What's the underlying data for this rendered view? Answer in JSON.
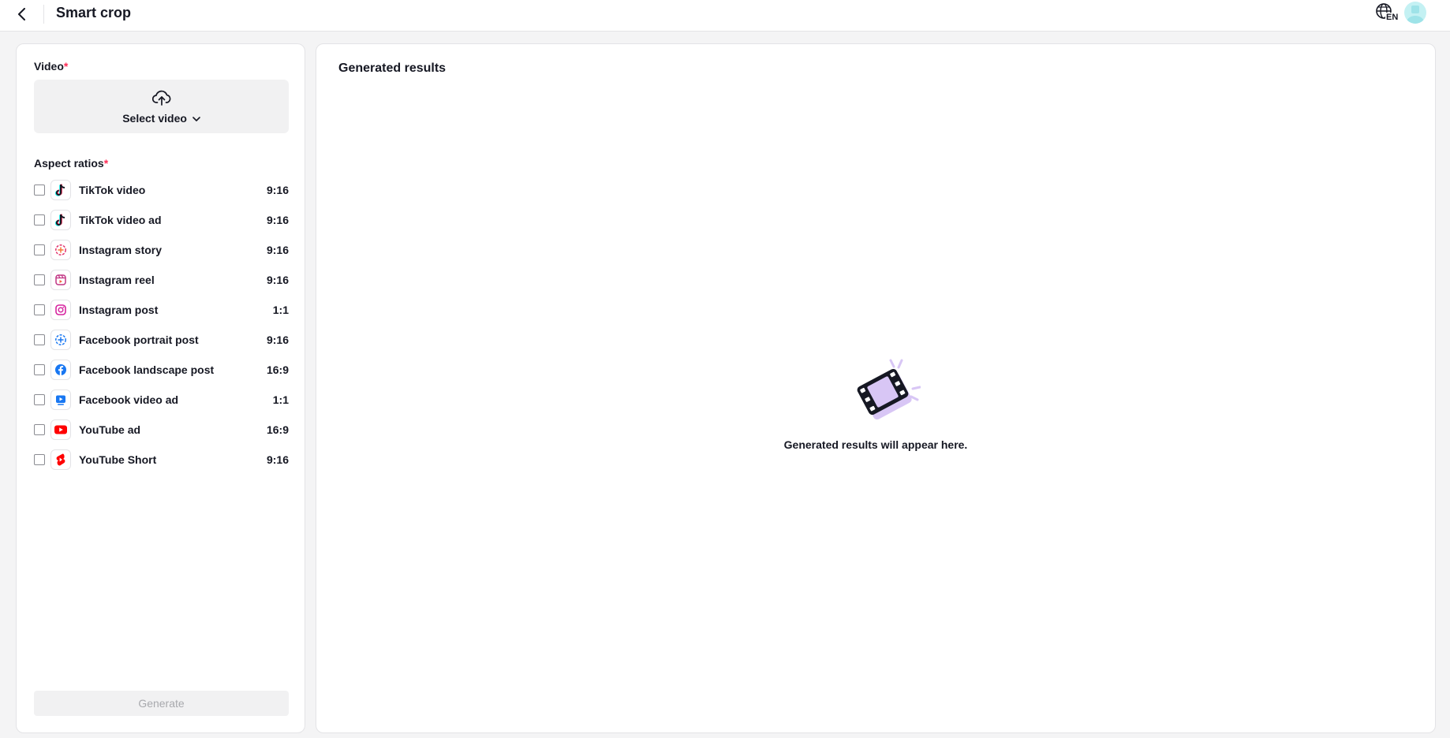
{
  "header": {
    "title": "Smart crop",
    "back_icon": "chevron-left-icon",
    "language_icon": "globe-icon",
    "language_code": "EN"
  },
  "left_panel": {
    "video_label": "Video",
    "required_mark": "*",
    "select_video_label": "Select video",
    "aspect_ratios_label": "Aspect ratios",
    "aspect_ratios": [
      {
        "name": "TikTok video",
        "ratio": "9:16",
        "icon": "tiktok-icon",
        "checked": false
      },
      {
        "name": "TikTok video ad",
        "ratio": "9:16",
        "icon": "tiktok-icon",
        "checked": false
      },
      {
        "name": "Instagram story",
        "ratio": "9:16",
        "icon": "instagram-story-icon",
        "checked": false
      },
      {
        "name": "Instagram reel",
        "ratio": "9:16",
        "icon": "instagram-reel-icon",
        "checked": false
      },
      {
        "name": "Instagram post",
        "ratio": "1:1",
        "icon": "instagram-icon",
        "checked": false
      },
      {
        "name": "Facebook portrait post",
        "ratio": "9:16",
        "icon": "facebook-story-icon",
        "checked": false
      },
      {
        "name": "Facebook landscape post",
        "ratio": "16:9",
        "icon": "facebook-icon",
        "checked": false
      },
      {
        "name": "Facebook video ad",
        "ratio": "1:1",
        "icon": "facebook-video-icon",
        "checked": false
      },
      {
        "name": "YouTube ad",
        "ratio": "16:9",
        "icon": "youtube-icon",
        "checked": false
      },
      {
        "name": "YouTube Short",
        "ratio": "9:16",
        "icon": "youtube-shorts-icon",
        "checked": false
      }
    ],
    "generate_label": "Generate"
  },
  "right_panel": {
    "title": "Generated results",
    "empty_message": "Generated results will appear here."
  },
  "colors": {
    "accent_required": "#fe2c55",
    "illustration_purple": "#d8c6f5"
  }
}
